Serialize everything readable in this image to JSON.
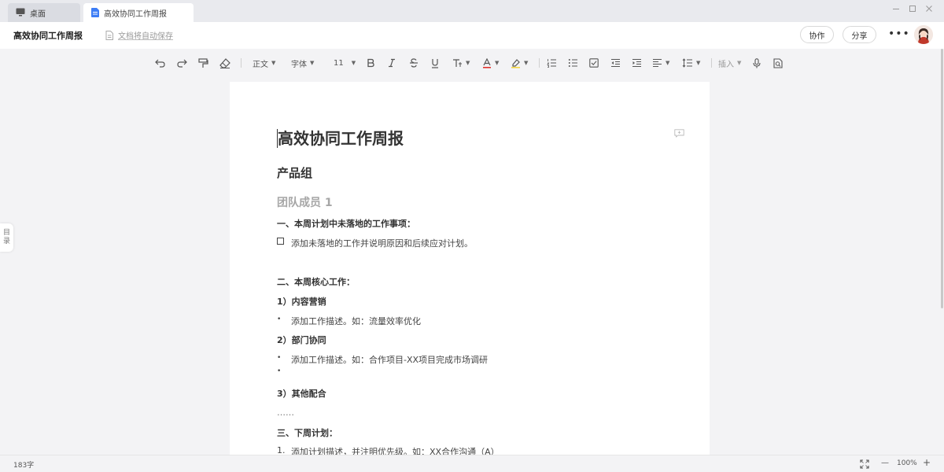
{
  "tabs": [
    {
      "label": "桌面",
      "icon": "monitor-icon"
    },
    {
      "label": "高效协同工作周报",
      "icon": "doc-icon"
    }
  ],
  "window_controls": [
    "minimize-icon",
    "maximize-icon",
    "close-icon"
  ],
  "header": {
    "title": "高效协同工作周报",
    "autosave": "文档将自动保存",
    "collaborate_label": "协作",
    "share_label": "分享",
    "more_label": "•••"
  },
  "toolbar": {
    "style_label": "正文",
    "font_label": "字体",
    "size_label": "11",
    "insert_label": "插入",
    "icons": [
      "undo-icon",
      "redo-icon",
      "format-painter-icon",
      "clear-format-icon",
      "bold-icon",
      "italic-icon",
      "strikethrough-icon",
      "underline-icon",
      "text-effects-icon",
      "font-color-icon",
      "highlight-icon",
      "ordered-list-icon",
      "bullet-list-icon",
      "checklist-icon",
      "outdent-icon",
      "indent-icon",
      "align-icon",
      "line-spacing-icon",
      "voice-icon",
      "find-replace-icon"
    ],
    "accent_font_color": "#e0322d",
    "accent_highlight": "#f5d742"
  },
  "document": {
    "h1": "高效协同工作周报",
    "h2": "产品组",
    "h3": "团队成员 1",
    "section1": "一、本周计划中未落地的工作事项：",
    "task1": "添加未落地的工作并说明原因和后续应对计划。",
    "section2": "二、本周核心工作：",
    "sub1": "1）内容营销",
    "item1": "添加工作描述。如：流量效率优化",
    "sub2": "2）部门协同",
    "item2": "添加工作描述。如：合作项目-XX项目完成市场调研",
    "sub3": "3）其他配合",
    "ellipsis": "……",
    "section3": "三、下周计划：",
    "plan1_num": "1.",
    "plan1": "添加计划描述，并注明优先级。如：XX合作沟通（A）",
    "bullet": "•"
  },
  "toc": {
    "label_top": "目",
    "label_bottom": "录"
  },
  "status": {
    "word_count": "183字",
    "zoom": "100%",
    "zoom_out": "—",
    "zoom_in": "+"
  }
}
